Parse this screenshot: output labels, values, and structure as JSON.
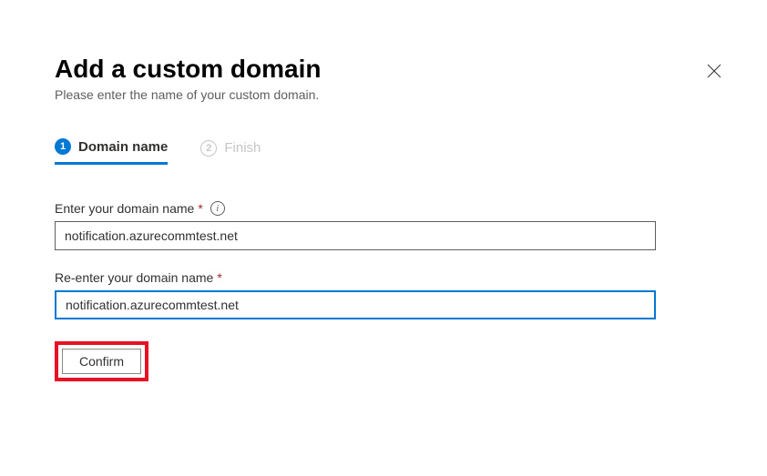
{
  "header": {
    "title": "Add a custom domain",
    "subtitle": "Please enter the name of your custom domain."
  },
  "steps": {
    "step1": {
      "num": "1",
      "label": "Domain name"
    },
    "step2": {
      "num": "2",
      "label": "Finish"
    }
  },
  "form": {
    "domain_label": "Enter your domain name",
    "domain_value": "notification.azurecommtest.net",
    "reenter_label": "Re-enter your domain name",
    "reenter_value": "notification.azurecommtest.net",
    "confirm_label": "Confirm"
  },
  "icons": {
    "info": "i"
  }
}
